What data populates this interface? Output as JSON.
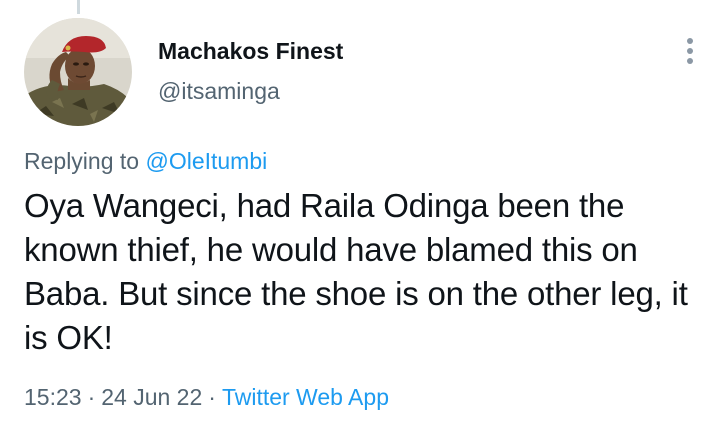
{
  "author": {
    "display_name": "Machakos Finest",
    "handle": "@itsaminga"
  },
  "reply": {
    "prefix": "Replying to",
    "mention": "@OleItumbi"
  },
  "tweet": {
    "text": "Oya Wangeci, had Raila Odinga been the known thief, he would have blamed this on Baba. But since the shoe is on the other leg, it is OK!"
  },
  "meta": {
    "time": "15:23",
    "separator": "·",
    "date": "24 Jun 22",
    "source": "Twitter Web App"
  },
  "icons": {
    "more": "more-vertical-icon",
    "avatar": "avatar-saluting-soldier"
  },
  "colors": {
    "link": "#1d9bf0",
    "secondary_text": "#536471",
    "primary_text": "#0f1419"
  }
}
